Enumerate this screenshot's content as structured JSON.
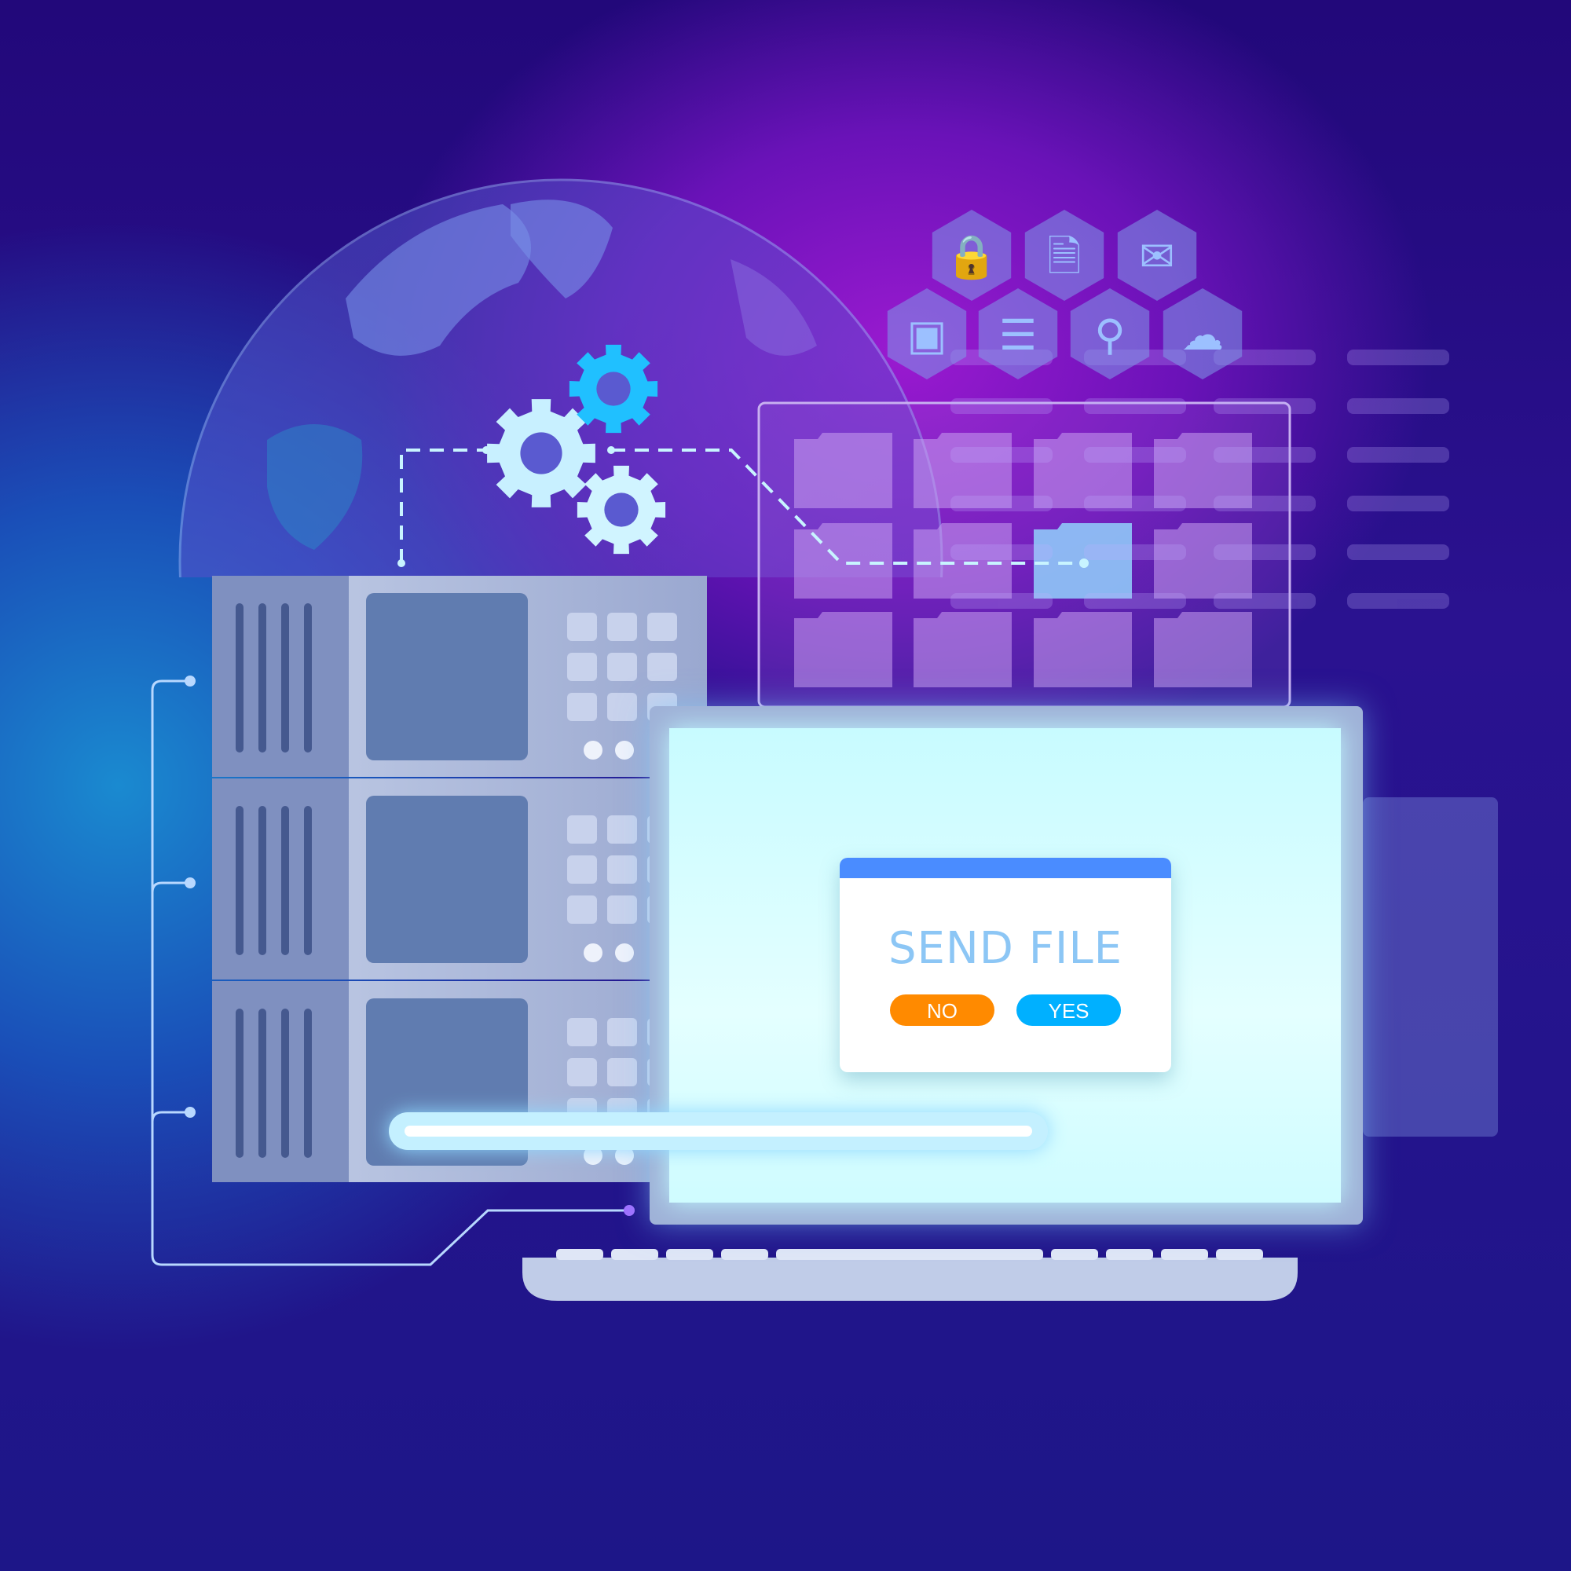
{
  "dialog": {
    "title": "SEND FILE",
    "no_label": "NO",
    "yes_label": "YES",
    "title_color": "#8cc6f5",
    "bar_color": "#4a8cff",
    "no_color": "#ff8a00",
    "yes_color": "#00b0ff"
  },
  "progress": {
    "value": 1.0
  },
  "icons": [
    "lock-icon",
    "document-icon",
    "mail-icon",
    "chip-icon",
    "database-icon",
    "search-icon",
    "cloud-icon"
  ]
}
